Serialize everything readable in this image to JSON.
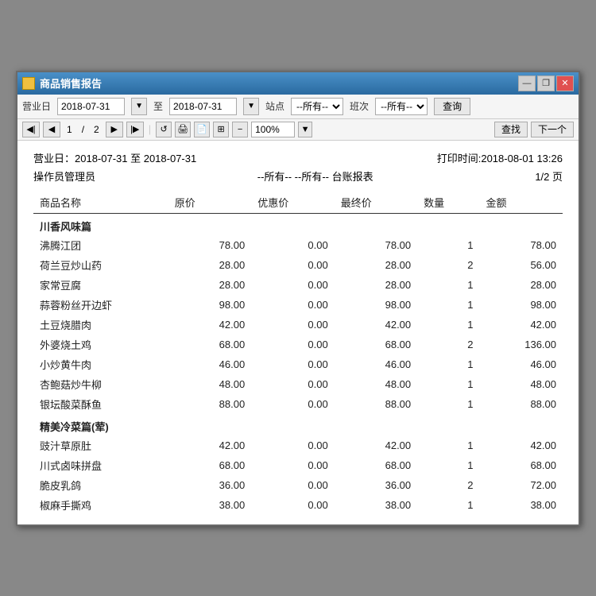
{
  "window": {
    "title": "商品销售报告",
    "controls": {
      "minimize": "—",
      "restore": "❐",
      "close": "✕"
    }
  },
  "toolbar": {
    "date_label": "营业日",
    "date_from": "2018-07-31",
    "date_to_label": "至",
    "date_to": "2018-07-31",
    "station_label": "站点",
    "station_value": "--所有--",
    "class_label": "班次",
    "class_value": "--所有--",
    "query_btn": "查询"
  },
  "navbar": {
    "first": "◀◀",
    "prev": "◀",
    "page_current": "1",
    "page_total": "2",
    "next": "▶",
    "last": "▶▶",
    "zoom": "100%",
    "find_btn": "查找",
    "next_btn": "下一个"
  },
  "report": {
    "date_range": "营业日：2018-07-31 至 2018-07-31",
    "print_time": "打印时间:2018-08-01 13:26",
    "operator": "操作员管理员",
    "filter": "--所有-- --所有-- 台账报表",
    "page_info": "1/2 页",
    "columns": {
      "name": "商品名称",
      "original_price": "原价",
      "sale_price": "优惠价",
      "final_price": "最终价",
      "quantity": "数量",
      "amount": "金额"
    },
    "sections": [
      {
        "section_name": "川香风味篇",
        "items": [
          {
            "name": "沸腾江团",
            "original": "78.00",
            "sale": "0.00",
            "final": "78.00",
            "qty": "1",
            "amount": "78.00"
          },
          {
            "name": "荷兰豆炒山药",
            "original": "28.00",
            "sale": "0.00",
            "final": "28.00",
            "qty": "2",
            "amount": "56.00"
          },
          {
            "name": "家常豆腐",
            "original": "28.00",
            "sale": "0.00",
            "final": "28.00",
            "qty": "1",
            "amount": "28.00"
          },
          {
            "name": "蒜蓉粉丝开边虾",
            "original": "98.00",
            "sale": "0.00",
            "final": "98.00",
            "qty": "1",
            "amount": "98.00"
          },
          {
            "name": "土豆烧腊肉",
            "original": "42.00",
            "sale": "0.00",
            "final": "42.00",
            "qty": "1",
            "amount": "42.00"
          },
          {
            "name": "外婆烧土鸡",
            "original": "68.00",
            "sale": "0.00",
            "final": "68.00",
            "qty": "2",
            "amount": "136.00"
          },
          {
            "name": "小炒黄牛肉",
            "original": "46.00",
            "sale": "0.00",
            "final": "46.00",
            "qty": "1",
            "amount": "46.00"
          },
          {
            "name": "杏鲍菇炒牛柳",
            "original": "48.00",
            "sale": "0.00",
            "final": "48.00",
            "qty": "1",
            "amount": "48.00"
          },
          {
            "name": "银坛酸菜酥鱼",
            "original": "88.00",
            "sale": "0.00",
            "final": "88.00",
            "qty": "1",
            "amount": "88.00"
          }
        ]
      },
      {
        "section_name": "精美冷菜篇(荤)",
        "items": [
          {
            "name": "豉汁草原肚",
            "original": "42.00",
            "sale": "0.00",
            "final": "42.00",
            "qty": "1",
            "amount": "42.00"
          },
          {
            "name": "川式卤味拼盘",
            "original": "68.00",
            "sale": "0.00",
            "final": "68.00",
            "qty": "1",
            "amount": "68.00"
          },
          {
            "name": "脆皮乳鸽",
            "original": "36.00",
            "sale": "0.00",
            "final": "36.00",
            "qty": "2",
            "amount": "72.00"
          },
          {
            "name": "椒麻手撕鸡",
            "original": "38.00",
            "sale": "0.00",
            "final": "38.00",
            "qty": "1",
            "amount": "38.00"
          }
        ]
      }
    ]
  }
}
